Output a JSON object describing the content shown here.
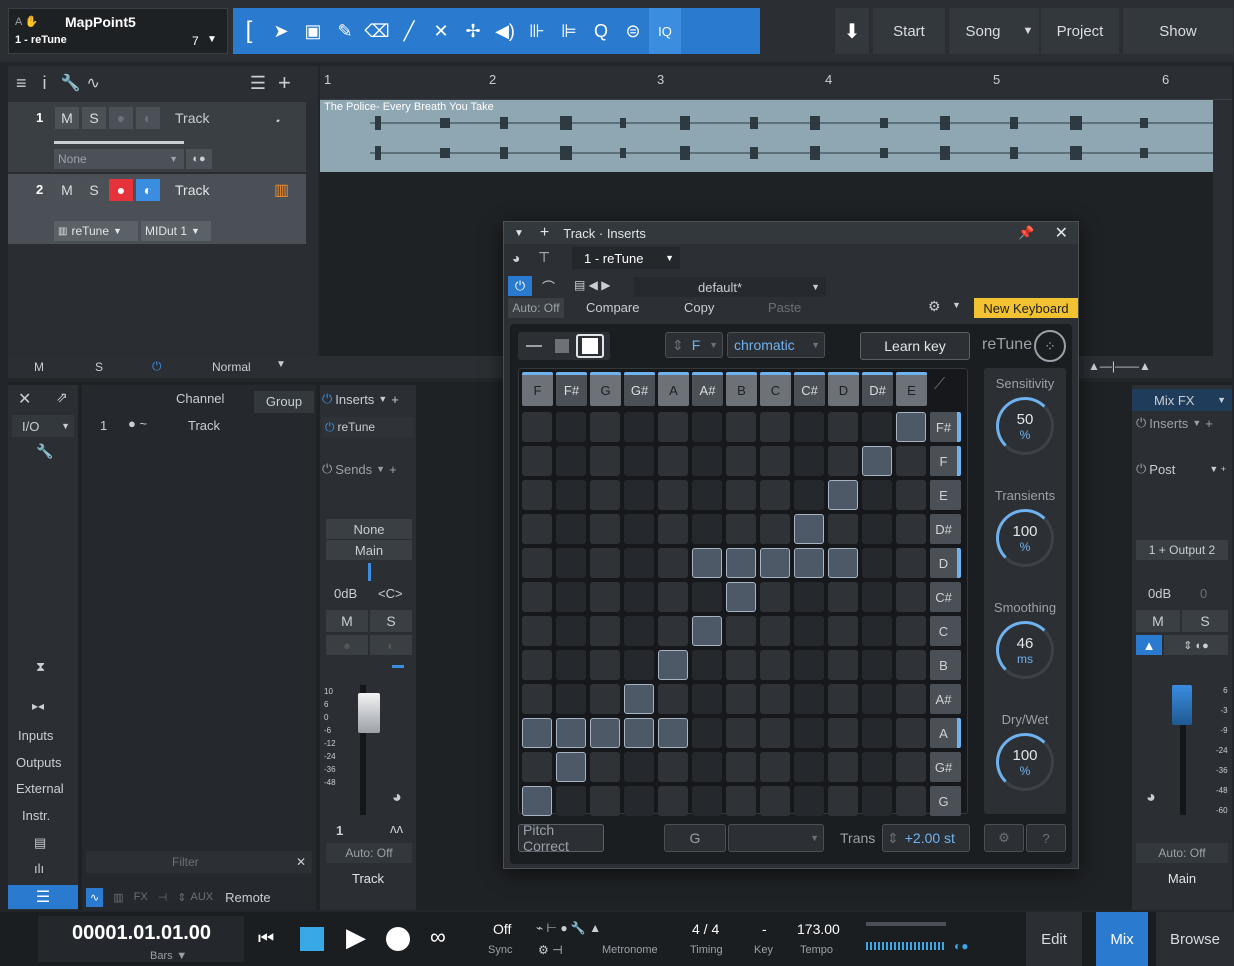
{
  "song": {
    "title": "MapPoint5",
    "subtitle": "1 - reTune",
    "count": "7"
  },
  "topnav": {
    "start": "Start",
    "song": "Song",
    "project": "Project",
    "show": "Show",
    "iq": "IQ"
  },
  "ruler": {
    "marks": [
      "1",
      "2",
      "3",
      "4",
      "5",
      "6"
    ]
  },
  "tracks": [
    {
      "num": "1",
      "m": "M",
      "s": "S",
      "name": "Track",
      "route": "None"
    },
    {
      "num": "2",
      "m": "M",
      "s": "S",
      "name": "Track",
      "route": "reTune",
      "midi": "MIDut 1"
    }
  ],
  "clip": {
    "name": "The Police- Every Breath You Take"
  },
  "statusrow": {
    "m": "M",
    "s": "S",
    "mode": "Normal"
  },
  "mixer": {
    "left": {
      "io": "I/O",
      "inputs": "Inputs",
      "outputs": "Outputs",
      "external": "External",
      "instr": "Instr."
    },
    "chanlist": {
      "h_channel": "Channel",
      "h_group": "Group",
      "row_num": "1",
      "row_name": "Track",
      "filter": "Filter"
    },
    "strip": {
      "inserts": "Inserts",
      "insert1": "reTune",
      "sends": "Sends",
      "none": "None",
      "main": "Main",
      "db": "0dB",
      "pan": "<C>",
      "m": "M",
      "s": "S",
      "num": "1",
      "auto": "Auto: Off",
      "name": "Track",
      "scale": [
        "10",
        "6",
        "0",
        "-6",
        "-12",
        "-24",
        "-36",
        "-48"
      ]
    },
    "rstrip": {
      "mixfx": "Mix FX",
      "inserts": "Inserts",
      "post": "Post",
      "output": "1 + Output 2",
      "db": "0dB",
      "zero": "0",
      "m": "M",
      "s": "S",
      "auto": "Auto: Off",
      "name": "Main",
      "scale": [
        "6",
        "-3",
        "-9",
        "-24",
        "-36",
        "-48",
        "-60"
      ]
    },
    "bottomtabs": {
      "fx": "FX",
      "aux": "AUX",
      "remote": "Remote"
    }
  },
  "plugin": {
    "title": "Track · Inserts",
    "instance": "1 - reTune",
    "preset": "default*",
    "auto": "Auto: Off",
    "compare": "Compare",
    "copy": "Copy",
    "paste": "Paste",
    "new_keyboard": "New Keyboard",
    "key": "F",
    "scale": "chromatic",
    "learn_key": "Learn key",
    "logo": "reTune",
    "columns": [
      "F",
      "F#",
      "G",
      "G#",
      "A",
      "A#",
      "B",
      "C",
      "C#",
      "D",
      "D#",
      "E"
    ],
    "rows": [
      "F#",
      "F",
      "E",
      "D#",
      "D",
      "C#",
      "C",
      "B",
      "A#",
      "A",
      "G#",
      "G"
    ],
    "knobs": [
      {
        "label": "Sensitivity",
        "value": "50",
        "unit": "%"
      },
      {
        "label": "Transients",
        "value": "100",
        "unit": "%"
      },
      {
        "label": "Smoothing",
        "value": "46",
        "unit": "ms"
      },
      {
        "label": "Dry/Wet",
        "value": "100",
        "unit": "%"
      }
    ],
    "pitch_correct": "Pitch Correct",
    "target": "G",
    "trans_label": "Trans",
    "trans_value": "+2.00 st"
  },
  "transport": {
    "time": "00001.01.01.00",
    "time_unit": "Bars",
    "sync": "Off",
    "sync_lbl": "Sync",
    "metronome": "Metronome",
    "timing": "4 / 4",
    "timing_lbl": "Timing",
    "key": "-",
    "key_lbl": "Key",
    "tempo": "173.00",
    "tempo_lbl": "Tempo",
    "edit": "Edit",
    "mix": "Mix",
    "browse": "Browse"
  },
  "colors": {
    "accent": "#2a7bd0",
    "clip": "#8fa6b3",
    "record": "#e5323b",
    "new_keyboard": "#f2c232"
  }
}
